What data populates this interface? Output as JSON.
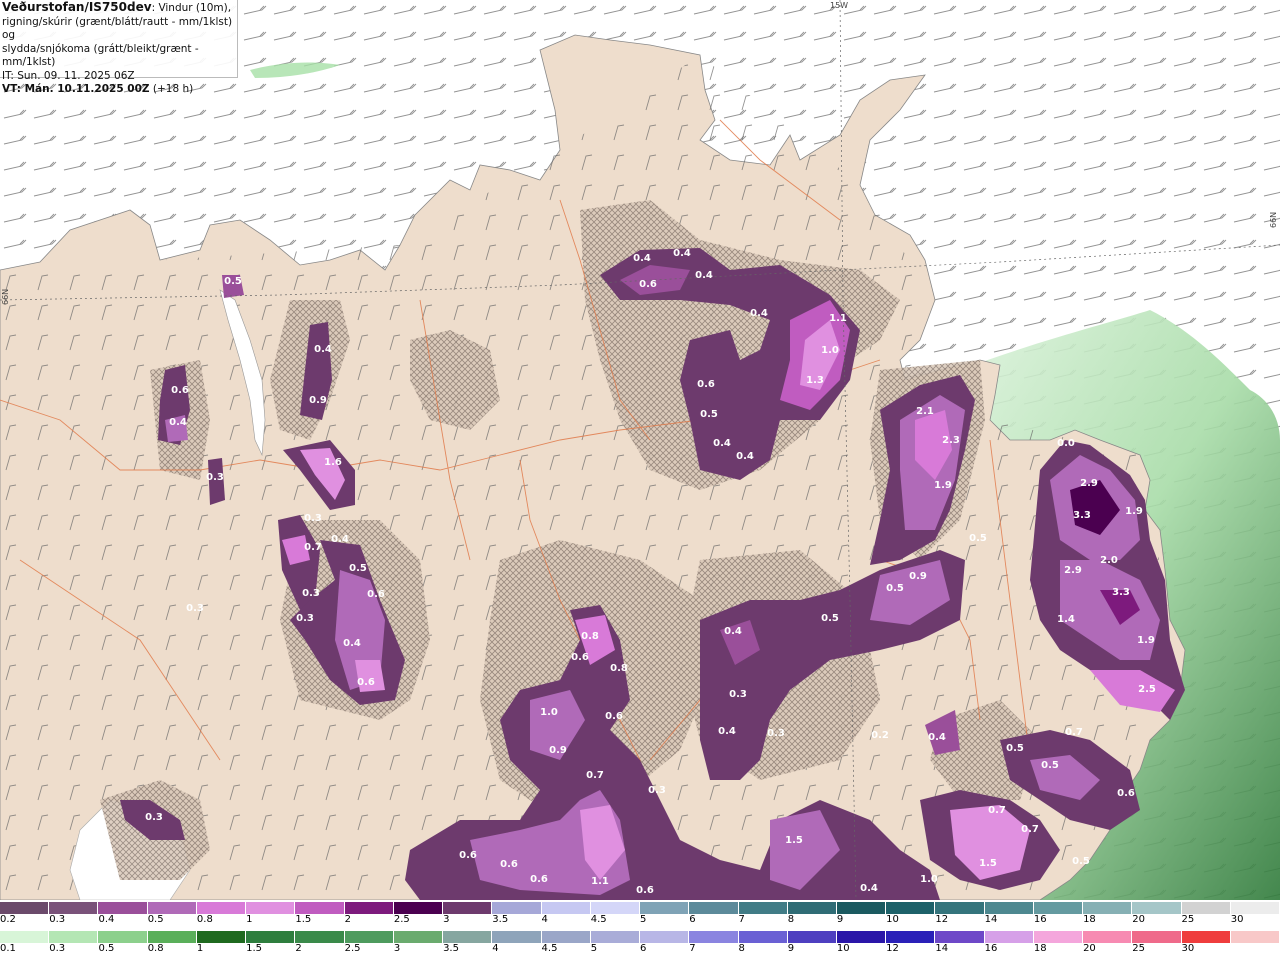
{
  "header": {
    "source": "Veðurstofan/IS750dev",
    "line1_suffix": ": Vindur (10m),",
    "line2": "rigning/skúrir (grænt/blátt/rautt - mm/1klst) og",
    "line3": "slydda/snjókoma (grátt/bleikt/grænt - mm/1klst)",
    "it_line": "IT: Sun. 09. 11. 2025 06Z",
    "vt_line": "VT: Mán. 10.11.2025 00Z",
    "vt_offset": " (+18 h)"
  },
  "grid_labels": {
    "top_longitude": "15W",
    "left_latitude": "66N",
    "right_latitude": "66N"
  },
  "map_values": [
    "0.4",
    "0.4",
    "0.4",
    "0.6",
    "0.4",
    "1.1",
    "1.0",
    "1.3",
    "0.6",
    "0.5",
    "0.4",
    "0.4",
    "0.6",
    "0.3",
    "0.5",
    "0.4",
    "0.9",
    "0.4",
    "1.6",
    "0.3",
    "0.7",
    "0.4",
    "0.5",
    "0.3",
    "0.6",
    "0.3",
    "0.4",
    "0.6",
    "0.3",
    "0.8",
    "0.6",
    "0.8",
    "1.0",
    "0.6",
    "0.9",
    "0.7",
    "0.3",
    "0.5",
    "0.4",
    "0.3",
    "0.4",
    "0.3",
    "0.5",
    "0.9",
    "0.5",
    "2.1",
    "2.3",
    "1.9",
    "0.0",
    "2.9",
    "3.3",
    "1.9",
    "2.9",
    "2.0",
    "3.3",
    "1.4",
    "1.9",
    "2.5",
    "0.7",
    "0.5",
    "0.5",
    "0.6",
    "0.7",
    "0.7",
    "1.5",
    "0.5",
    "0.2",
    "0.4",
    "0.6",
    "0.6",
    "0.6",
    "1.1",
    "0.6",
    "1.5",
    "0.4",
    "1.0",
    "0.3"
  ],
  "legend_precip": {
    "labels": [
      "0.2",
      "0.3",
      "0.4",
      "0.5",
      "0.8",
      "1",
      "1.5",
      "2",
      "2.5",
      "3",
      "3.5",
      "4",
      "4.5",
      "5",
      "6",
      "7",
      "8",
      "9",
      "10",
      "12",
      "14",
      "16",
      "18",
      "20",
      "25",
      "30"
    ],
    "colors": [
      "#6b4a6b",
      "#7a527a",
      "#9a4f9a",
      "#b06ab8",
      "#d87ad8",
      "#e090e0",
      "#c05cc0",
      "#7d1a7d",
      "#4b0050",
      "#6d3a6d",
      "#a6a8d8",
      "#c6c8f2",
      "#d4d6f8",
      "#7fa3b6",
      "#5c8a9a",
      "#417c86",
      "#2f6c75",
      "#1b5a60",
      "#1d6169",
      "#34747c",
      "#4d8890",
      "#649aa0",
      "#86b0b4",
      "#a5c6c8",
      "#d2d2d2",
      "#ececec"
    ]
  },
  "legend_snow": {
    "labels": [
      "0.1",
      "0.3",
      "0.5",
      "0.8",
      "1",
      "1.5",
      "2",
      "2.5",
      "3",
      "3.5",
      "4",
      "4.5",
      "5",
      "6",
      "7",
      "8",
      "9",
      "10",
      "12",
      "14",
      "16",
      "18",
      "20",
      "25",
      "30"
    ],
    "colors": [
      "#d8f5d8",
      "#b4e6b4",
      "#8cd08c",
      "#5aaf5a",
      "#1f6a1f",
      "#2e7e3e",
      "#3a8a4a",
      "#4e9b5e",
      "#6aab6e",
      "#86a6a0",
      "#8ea4ba",
      "#9aa6c8",
      "#a9acd8",
      "#b8b6e6",
      "#8a84e0",
      "#6a60d4",
      "#4e3fc0",
      "#2a16a8",
      "#2a20b8",
      "#6e48c8",
      "#d6a0e8",
      "#f4a6dc",
      "#f78ab2",
      "#ef6a8a",
      "#ef3d3d",
      "#f8c8c8"
    ]
  }
}
